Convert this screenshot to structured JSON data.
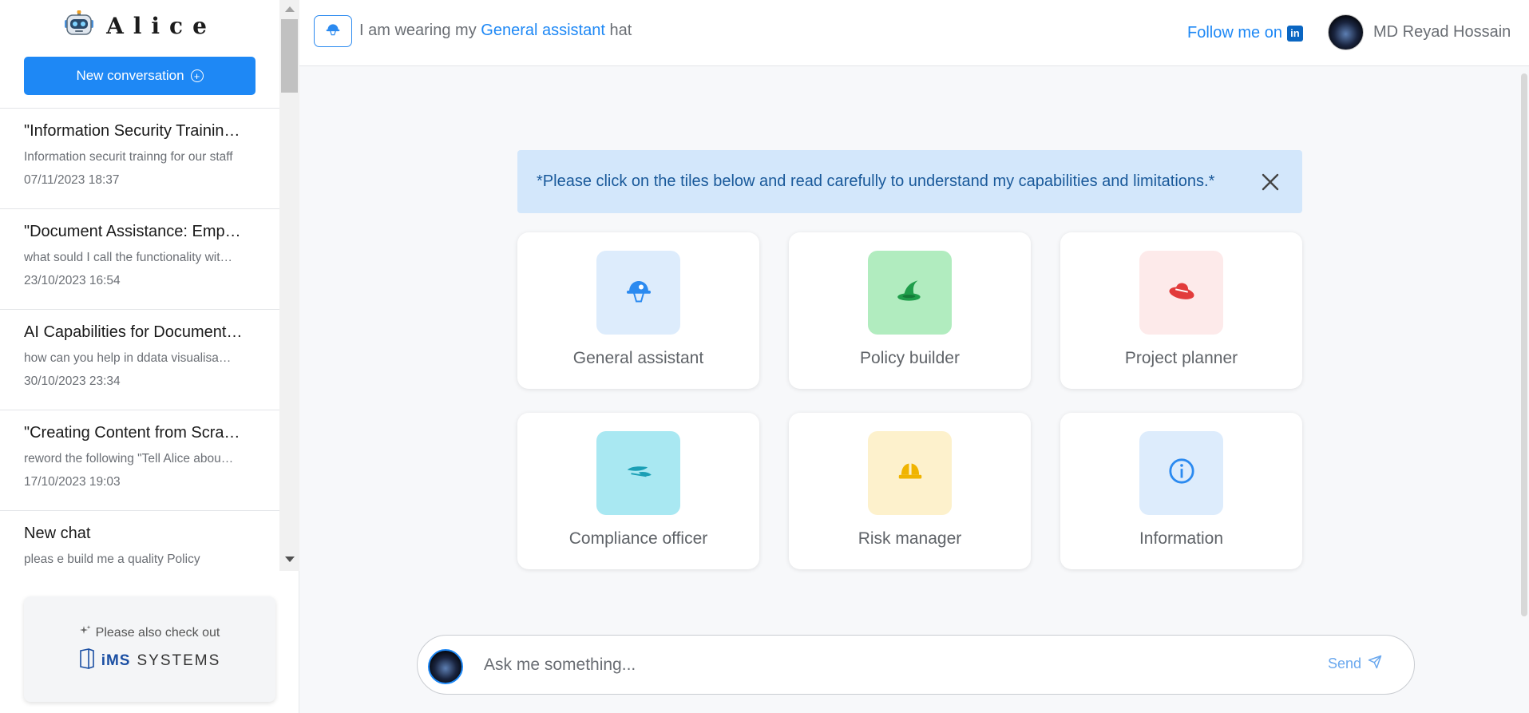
{
  "app": {
    "title": "Alice",
    "new_conversation_label": "New conversation"
  },
  "conversations": [
    {
      "title": "\"Information Security Trainin…",
      "preview": "Information securit trainng for our staff",
      "date": "07/11/2023 18:37"
    },
    {
      "title": "\"Document Assistance: Emp…",
      "preview": "what sould I call the functionality wit…",
      "date": "23/10/2023 16:54"
    },
    {
      "title": "AI Capabilities for Document…",
      "preview": "how can you help in ddata visualisa…",
      "date": "30/10/2023 23:34"
    },
    {
      "title": "\"Creating Content from Scra…",
      "preview": "reword the following \"Tell Alice abou…",
      "date": "17/10/2023 19:03"
    },
    {
      "title": "New chat",
      "preview": "pleas e build me a quality Policy",
      "date": ""
    }
  ],
  "promo": {
    "text": "Please also check out",
    "brand_ims": "iMS",
    "brand_systems": "SYSTEMS"
  },
  "header": {
    "wearing_prefix": "I am wearing my",
    "current_role": "General assistant",
    "wearing_suffix": "hat",
    "follow_label": "Follow me on",
    "linkedin_glyph": "in",
    "user_name": "MD Reyad Hossain"
  },
  "notice": {
    "text": "*Please click on the tiles below and read carefully to understand my capabilities and limitations.*"
  },
  "tiles": [
    {
      "label": "General assistant",
      "icon": "helmet-hat-icon",
      "bg": "#ddecfc",
      "color": "#2b8af0"
    },
    {
      "label": "Policy builder",
      "icon": "witch-hat-icon",
      "bg": "#b1ecbf",
      "color": "#1f9d4a"
    },
    {
      "label": "Project planner",
      "icon": "fedora-hat-icon",
      "bg": "#fdeaea",
      "color": "#e23b3b"
    },
    {
      "label": "Compliance officer",
      "icon": "cap-hat-icon",
      "bg": "#a9e8f2",
      "color": "#1a9fb5"
    },
    {
      "label": "Risk manager",
      "icon": "hard-hat-icon",
      "bg": "#fdf1cc",
      "color": "#f0b400"
    },
    {
      "label": "Information",
      "icon": "info-icon",
      "bg": "#ddecfc",
      "color": "#2b8af0"
    }
  ],
  "ask": {
    "placeholder": "Ask me something...",
    "send_label": "Send"
  }
}
